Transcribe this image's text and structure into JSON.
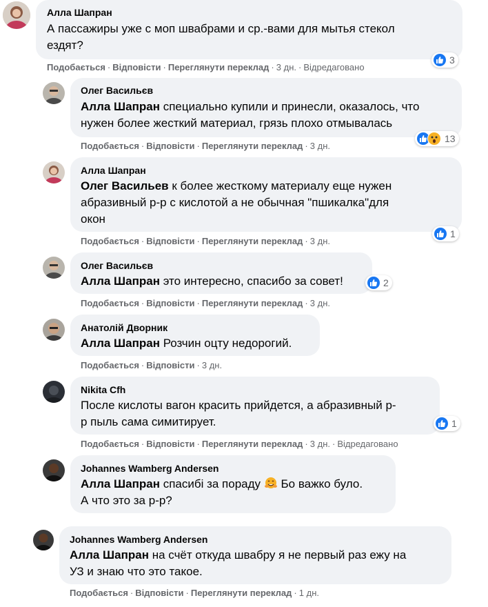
{
  "actions": {
    "like": "Подобається",
    "reply": "Відповісти",
    "translate": "Переглянути переклад",
    "edited": "Відредаговано",
    "dot": "·"
  },
  "comments": [
    {
      "author": "Алла Шапран",
      "mention": "",
      "lines": [
        "А пассажиры уже с моп швабрами и ср.-вами для мытья стекол",
        "ездят?"
      ],
      "time": "3 дн.",
      "edited": true,
      "has_translate": true,
      "reactions": {
        "types": [
          "like"
        ],
        "count": "3"
      }
    },
    {
      "author": "Олег Васильєв",
      "mention": "Алла Шапран",
      "lines": [
        " специально купили и принесли, оказалось, что",
        "нужен более жесткий материал, грязь плохо отмывалась"
      ],
      "time": "3 дн.",
      "edited": false,
      "has_translate": true,
      "reactions": {
        "types": [
          "like",
          "wow"
        ],
        "count": "13"
      }
    },
    {
      "author": "Алла Шапран",
      "mention": "Олег Васильев",
      "lines": [
        " к более жесткому материалу еще нужен",
        "абразивный р-р с кислотой а не обычная \"пшикалка\"для",
        "окон"
      ],
      "time": "3 дн.",
      "edited": false,
      "has_translate": true,
      "reactions": {
        "types": [
          "like"
        ],
        "count": "1"
      }
    },
    {
      "author": "Олег Васильєв",
      "mention": "Алла Шапран",
      "lines": [
        " это интересно, спасибо за совет!"
      ],
      "time": "3 дн.",
      "edited": false,
      "has_translate": true,
      "reactions": {
        "types": [
          "like"
        ],
        "count": "2"
      }
    },
    {
      "author": "Анатолій Дворник",
      "mention": "Алла Шапран",
      "lines": [
        " Розчин оцту недорогий."
      ],
      "time": "3 дн.",
      "edited": false,
      "has_translate": false,
      "reactions": null
    },
    {
      "author": "Nikita Cfh",
      "mention": "",
      "lines": [
        "После кислоты вагон красить прийдется, а абразивный р-",
        "р пыль сама симитирует."
      ],
      "time": "3 дн.",
      "edited": true,
      "has_translate": true,
      "reactions": {
        "types": [
          "like"
        ],
        "count": "1"
      }
    },
    {
      "author": "Johannes Wamberg Andersen",
      "mention": "Алла Шапран",
      "lines": [
        " спасибі за пораду ",
        "А что это за р-р?"
      ],
      "emoji_after": " Бо важко було.",
      "time": "",
      "edited": false,
      "has_translate": false,
      "reactions": null
    },
    {
      "author": "Johannes Wamberg Andersen",
      "mention": "Алла Шапран",
      "lines": [
        " на счёт откуда швабру я не первый раз ежу на",
        "УЗ и знаю что это такое."
      ],
      "time": "1 дн.",
      "edited": false,
      "has_translate": true,
      "reactions": null
    }
  ],
  "colors": {
    "bubble": "#f0f2f5",
    "like": "#1877f2",
    "meta": "#65676b",
    "text": "#050505"
  }
}
